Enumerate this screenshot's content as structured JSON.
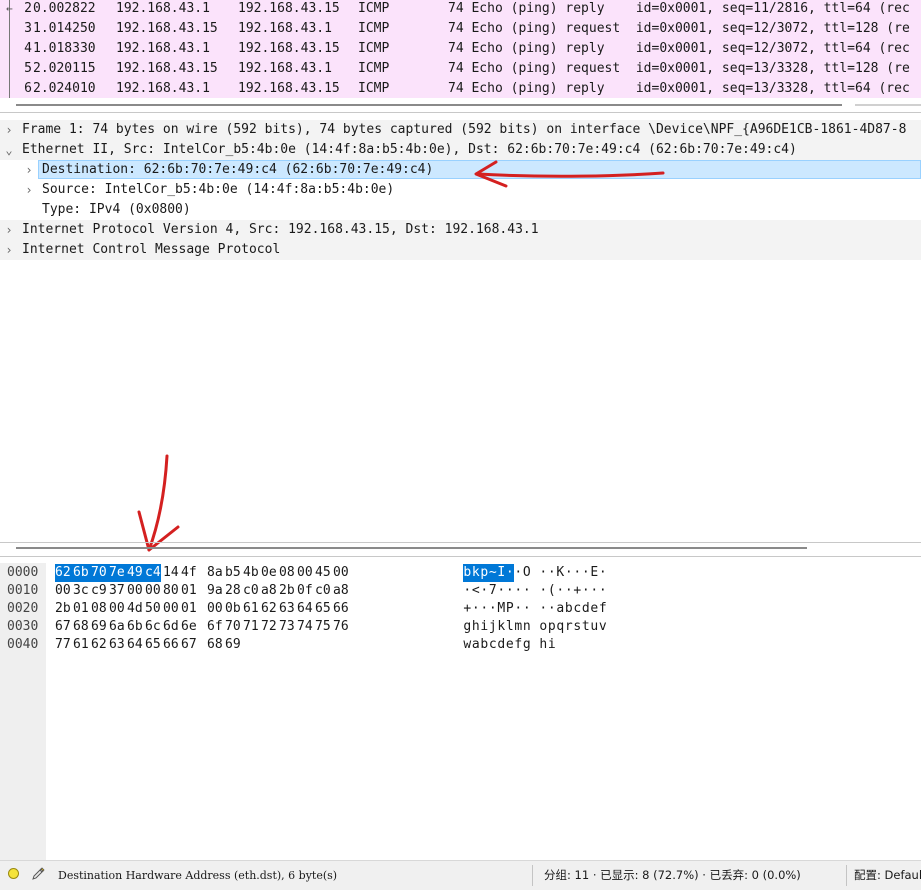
{
  "packets": [
    {
      "no": "2",
      "time": "0.002822",
      "src": "192.168.43.1",
      "dst": "192.168.43.15",
      "proto": "ICMP",
      "len_info": "74 Echo (ping) reply    id=0x0001, seq=11/2816, ttl=64 (rec"
    },
    {
      "no": "3",
      "time": "1.014250",
      "src": "192.168.43.15",
      "dst": "192.168.43.1",
      "proto": "ICMP",
      "len_info": "74 Echo (ping) request  id=0x0001, seq=12/3072, ttl=128 (re"
    },
    {
      "no": "4",
      "time": "1.018330",
      "src": "192.168.43.1",
      "dst": "192.168.43.15",
      "proto": "ICMP",
      "len_info": "74 Echo (ping) reply    id=0x0001, seq=12/3072, ttl=64 (rec"
    },
    {
      "no": "5",
      "time": "2.020115",
      "src": "192.168.43.15",
      "dst": "192.168.43.1",
      "proto": "ICMP",
      "len_info": "74 Echo (ping) request  id=0x0001, seq=13/3328, ttl=128 (re"
    },
    {
      "no": "6",
      "time": "2.024010",
      "src": "192.168.43.1",
      "dst": "192.168.43.15",
      "proto": "ICMP",
      "len_info": "74 Echo (ping) reply    id=0x0001, seq=13/3328, ttl=64 (rec"
    }
  ],
  "details": {
    "frame": "Frame 1: 74 bytes on wire (592 bits), 74 bytes captured (592 bits) on interface \\Device\\NPF_{A96DE1CB-1861-4D87-8",
    "ethernet": "Ethernet II, Src: IntelCor_b5:4b:0e (14:4f:8a:b5:4b:0e), Dst: 62:6b:70:7e:49:c4 (62:6b:70:7e:49:c4)",
    "destination": "Destination: 62:6b:70:7e:49:c4 (62:6b:70:7e:49:c4)",
    "source": "Source: IntelCor_b5:4b:0e (14:4f:8a:b5:4b:0e)",
    "type": "Type: IPv4 (0x0800)",
    "ip": "Internet Protocol Version 4, Src: 192.168.43.15, Dst: 192.168.43.1",
    "icmp": "Internet Control Message Protocol"
  },
  "hex": [
    {
      "offset": "0000",
      "bytes": [
        "62",
        "6b",
        "70",
        "7e",
        "49",
        "c4",
        "14",
        "4f",
        "8a",
        "b5",
        "4b",
        "0e",
        "08",
        "00",
        "45",
        "00"
      ],
      "ascii": [
        "b",
        "k",
        "p",
        "~",
        "I",
        "·",
        "·",
        "O",
        "·",
        "·",
        "K",
        "·",
        "·",
        "·",
        "E",
        "·"
      ]
    },
    {
      "offset": "0010",
      "bytes": [
        "00",
        "3c",
        "c9",
        "37",
        "00",
        "00",
        "80",
        "01",
        "9a",
        "28",
        "c0",
        "a8",
        "2b",
        "0f",
        "c0",
        "a8"
      ],
      "ascii": [
        "·",
        "<",
        "·",
        "7",
        "·",
        "·",
        "·",
        "·",
        "·",
        "(",
        "·",
        "·",
        "+",
        "·",
        "·",
        "·"
      ]
    },
    {
      "offset": "0020",
      "bytes": [
        "2b",
        "01",
        "08",
        "00",
        "4d",
        "50",
        "00",
        "01",
        "00",
        "0b",
        "61",
        "62",
        "63",
        "64",
        "65",
        "66"
      ],
      "ascii": [
        "+",
        "·",
        "·",
        "·",
        "M",
        "P",
        "·",
        "·",
        "·",
        "·",
        "a",
        "b",
        "c",
        "d",
        "e",
        "f"
      ]
    },
    {
      "offset": "0030",
      "bytes": [
        "67",
        "68",
        "69",
        "6a",
        "6b",
        "6c",
        "6d",
        "6e",
        "6f",
        "70",
        "71",
        "72",
        "73",
        "74",
        "75",
        "76"
      ],
      "ascii": [
        "g",
        "h",
        "i",
        "j",
        "k",
        "l",
        "m",
        "n",
        "o",
        "p",
        "q",
        "r",
        "s",
        "t",
        "u",
        "v"
      ]
    },
    {
      "offset": "0040",
      "bytes": [
        "77",
        "61",
        "62",
        "63",
        "64",
        "65",
        "66",
        "67",
        "68",
        "69"
      ],
      "ascii": [
        "w",
        "a",
        "b",
        "c",
        "d",
        "e",
        "f",
        "g",
        "h",
        "i"
      ]
    }
  ],
  "highlight_count": 6,
  "status": {
    "field": "Destination Hardware Address (eth.dst), 6 byte(s)",
    "stats": "分组: 11 · 已显示: 8 (72.7%) · 已丢弃: 0 (0.0%)",
    "profile": "配置: Default"
  },
  "colors": {
    "packet_row_bg": "#fbe3fb",
    "selection_bg": "#cce8ff",
    "byte_highlight": "#0078d7",
    "annotation": "#d42020"
  }
}
